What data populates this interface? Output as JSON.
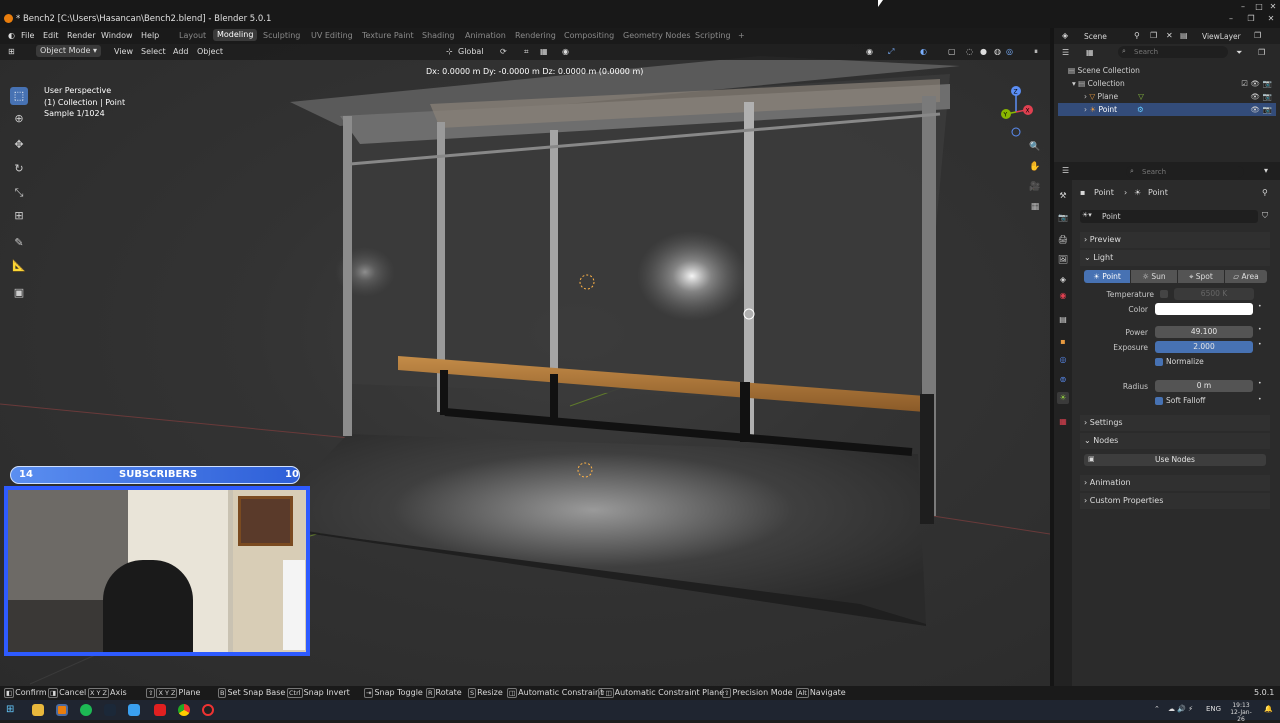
{
  "window": {
    "title": "* Bench2 [C:\\Users\\Hasancan\\Bench2.blend] - Blender 5.0.1"
  },
  "menus": [
    "File",
    "Edit",
    "Render",
    "Window",
    "Help"
  ],
  "workspaces": [
    "Layout",
    "Modeling",
    "Sculpting",
    "UV Editing",
    "Texture Paint",
    "Shading",
    "Animation",
    "Rendering",
    "Compositing",
    "Geometry Nodes",
    "Scripting"
  ],
  "workspace_plus": "+",
  "viewport_header": {
    "mode": "Object Mode",
    "view": "View",
    "select": "Select",
    "add": "Add",
    "object": "Object",
    "orientation": "Global"
  },
  "transform_readout": "Dx: 0.0000 m   Dy: -0.0000 m   Dz: 0.0000 m (0.0000 m)",
  "overlay": {
    "perspective": "User Perspective",
    "collection": "(1) Collection | Point",
    "sample": "Sample 1/1024"
  },
  "gizmo": {
    "z": "Z",
    "y": "Y",
    "x": "X"
  },
  "subscribers": {
    "left": "14",
    "label": "SUBSCRIBERS",
    "right": "10"
  },
  "outliner": {
    "scene": "Scene",
    "view_layer": "ViewLayer",
    "search_placeholder": "Search",
    "root": "Scene Collection",
    "collection": "Collection",
    "items": [
      "Plane",
      "Point"
    ]
  },
  "properties": {
    "search_placeholder": "Search",
    "breadcrumb_a": "Point",
    "breadcrumb_b": "Point",
    "datablock": "Point",
    "sections": {
      "preview": "Preview",
      "light": "Light",
      "settings": "Settings",
      "nodes": "Nodes",
      "animation": "Animation",
      "custom": "Custom Properties"
    },
    "light_types": [
      "Point",
      "Sun",
      "Spot",
      "Area"
    ],
    "temperature_label": "Temperature",
    "temperature_value": "6500 K",
    "color_label": "Color",
    "power_label": "Power",
    "power_value": "49.100",
    "exposure_label": "Exposure",
    "exposure_value": "2.000",
    "normalize_label": "Normalize",
    "radius_label": "Radius",
    "radius_value": "0 m",
    "soft_falloff_label": "Soft Falloff",
    "use_nodes": "Use Nodes"
  },
  "statusbar": [
    {
      "key": "",
      "label": "Confirm"
    },
    {
      "key": "",
      "label": "Cancel"
    },
    {
      "key": "X Y Z",
      "label": "Axis"
    },
    {
      "key": "X Y Z",
      "label": "Plane"
    },
    {
      "key": "",
      "label": "Set Snap Base"
    },
    {
      "key": "Ctrl",
      "label": "Snap Invert"
    },
    {
      "key": "",
      "label": "Snap Toggle"
    },
    {
      "key": "R",
      "label": "Rotate"
    },
    {
      "key": "S",
      "label": "Resize"
    },
    {
      "key": "",
      "label": "Automatic Constraint"
    },
    {
      "key": "",
      "label": "Automatic Constraint Plane"
    },
    {
      "key": "",
      "label": "Precision Mode"
    },
    {
      "key": "Alt",
      "label": "Navigate"
    }
  ],
  "version": "5.0.1",
  "taskbar": {
    "lang": "ENG",
    "time": "19:13",
    "date": "12-Jan-26"
  },
  "colors": {
    "accent": "#4772b3",
    "orange": "#e87d0d",
    "bench": "#b07a3c"
  }
}
